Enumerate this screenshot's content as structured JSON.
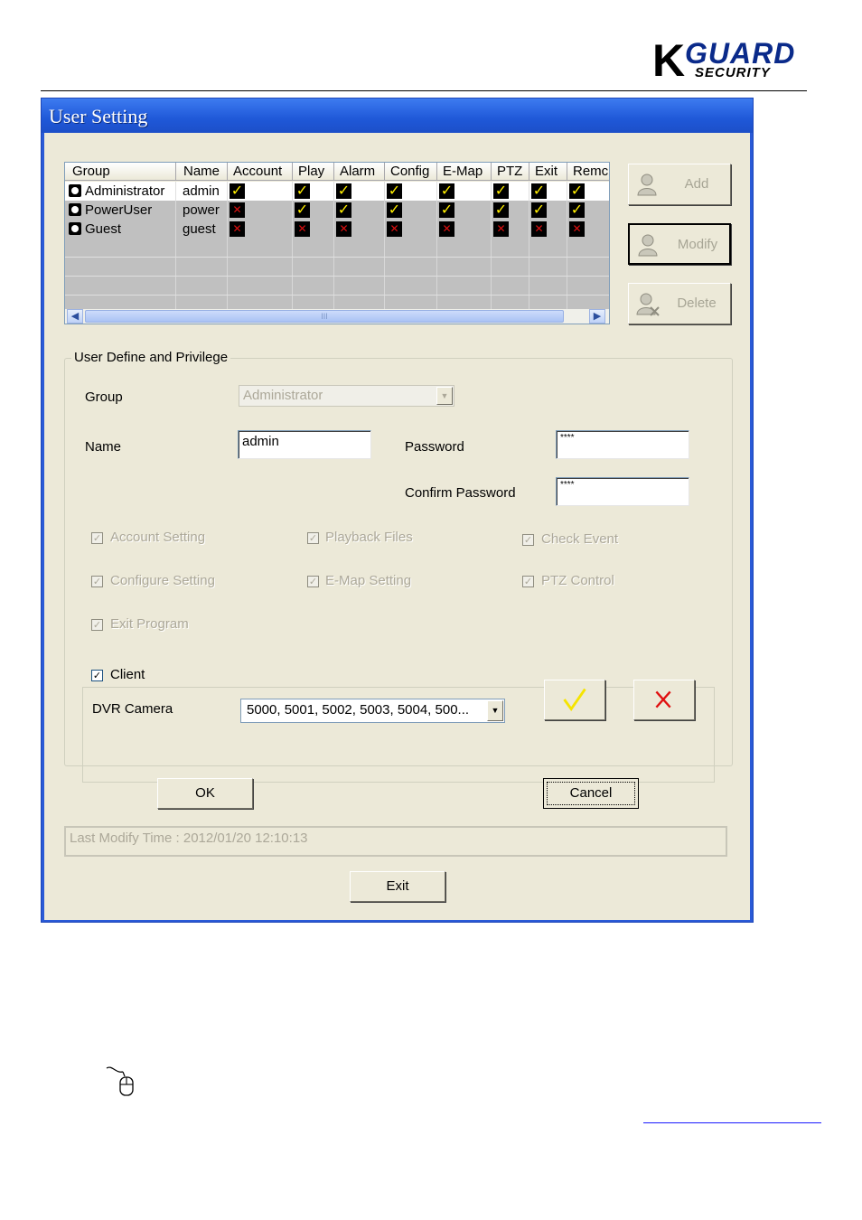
{
  "logo": {
    "k": "K",
    "guard": "GUARD",
    "security": "SECURITY"
  },
  "window": {
    "title": "User Setting"
  },
  "grid": {
    "columns": [
      "Group",
      "Name",
      "Account",
      "Play",
      "Alarm",
      "Config",
      "E-Map",
      "PTZ",
      "Exit",
      "Remc"
    ],
    "rows": [
      {
        "group": "Administrator",
        "name": "admin",
        "perms": [
          true,
          true,
          true,
          true,
          true,
          true,
          true,
          true
        ]
      },
      {
        "group": "PowerUser",
        "name": "power",
        "perms": [
          false,
          true,
          true,
          true,
          true,
          true,
          true,
          true
        ]
      },
      {
        "group": "Guest",
        "name": "guest",
        "perms": [
          false,
          false,
          false,
          false,
          false,
          false,
          false,
          false
        ]
      }
    ],
    "scroll_grip": "III"
  },
  "side_buttons": {
    "add": "Add",
    "modify": "Modify",
    "delete": "Delete"
  },
  "privilege": {
    "legend": "User Define and Privilege",
    "group_label": "Group",
    "group_value": "Administrator",
    "name_label": "Name",
    "name_value": "admin",
    "password_label": "Password",
    "password_value": "****",
    "confirm_label": "Confirm Password",
    "confirm_value": "****",
    "options": {
      "account_setting": "Account Setting",
      "playback_files": "Playback Files",
      "check_event": "Check Event",
      "configure_setting": "Configure Setting",
      "emap_setting": "E-Map Setting",
      "ptz_control": "PTZ Control",
      "exit_program": "Exit Program"
    },
    "client_label": "Client",
    "client_checked": true,
    "dvr_label": "DVR Camera",
    "dvr_value": "5000, 5001, 5002, 5003, 5004, 500...",
    "confirm_icon": "check-icon",
    "cancel_icon": "cross-icon"
  },
  "buttons": {
    "ok": "OK",
    "cancel": "Cancel",
    "exit": "Exit"
  },
  "status": {
    "text": "Last Modify Time : 2012/01/20 12:10:13"
  },
  "colors": {
    "title_bar": "#2a5ad7",
    "dialog_bg": "#ece9d8",
    "check_yes": "#ffee00",
    "check_no": "#e01010"
  }
}
